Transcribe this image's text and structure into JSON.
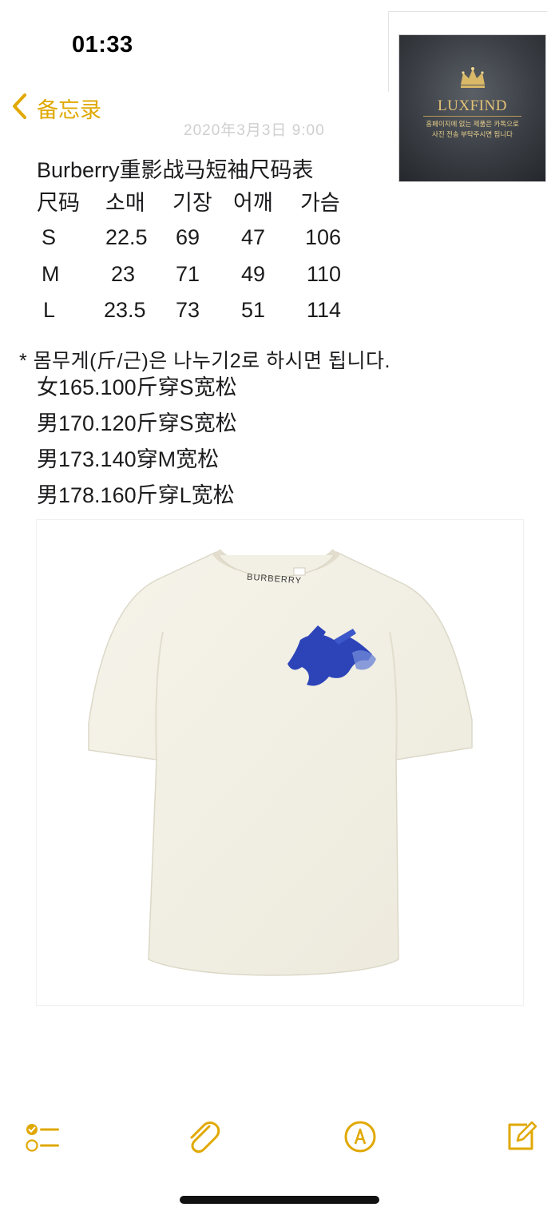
{
  "status_bar": {
    "time": "01:33"
  },
  "nav": {
    "back_label": "备忘录"
  },
  "ghost": {
    "date_text": "2020年3月3日 9:00"
  },
  "logo": {
    "brand": "LUXFIND",
    "line1": "홈페이지에 없는 제품은 카톡으로",
    "line2": "사진 전송 부탁주시면 됩니다",
    "accent": "#e3c276"
  },
  "note": {
    "title": "Burberry重影战马短袖尺码表",
    "table": {
      "headers": [
        "尺码",
        "소매",
        "기장",
        "어깨",
        "가슴"
      ],
      "rows": [
        [
          "S",
          "22.5",
          "69",
          "47",
          "106"
        ],
        [
          "M",
          "23",
          "71",
          "49",
          "110"
        ],
        [
          "L",
          "23.5",
          "73",
          "51",
          "114"
        ]
      ]
    },
    "weight_note": "* 몸무게(斤/근)은 나누기2로 하시면 됩니다.",
    "fit_lines": [
      "女165.100斤穿S宽松",
      "男170.120斤穿S宽松",
      "男173.140穿M宽松",
      "男178.160斤穿L宽松"
    ]
  },
  "product_image": {
    "collar_text": "BURBERRY",
    "tee_color": "#f4f2e8",
    "logo_color": "#2c44b8"
  },
  "toolbar": {
    "icons": [
      "checklist-icon",
      "paperclip-icon",
      "markup-pen-icon",
      "compose-icon"
    ],
    "accent": "#e0a800"
  }
}
